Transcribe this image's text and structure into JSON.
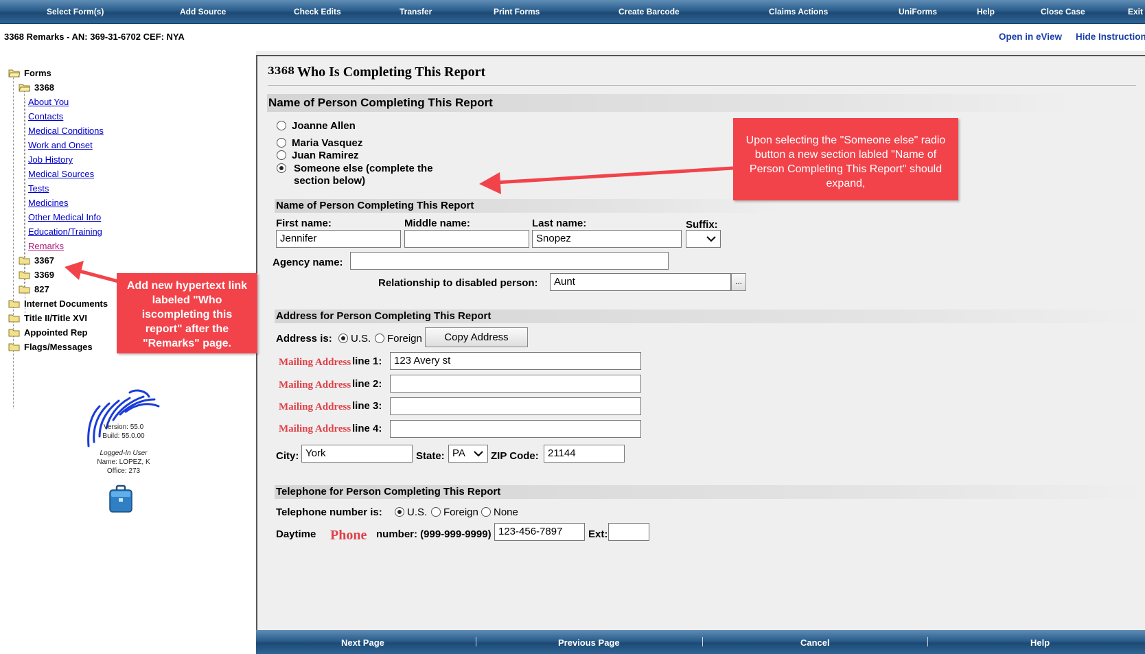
{
  "menu": {
    "items": [
      "Select Form(s)",
      "Add Source",
      "Check Edits",
      "Transfer",
      "Print Forms",
      "Create Barcode",
      "Claims Actions",
      "UniForms",
      "Help",
      "Close Case",
      "Exit"
    ]
  },
  "subheader": {
    "case_title": "3368 Remarks - AN: 369-31-6702 CEF: NYA",
    "open_eview": "Open in eView",
    "hide_instructions": "Hide Instruction"
  },
  "tree": {
    "forms": "Forms",
    "form_3368": "3368",
    "pages": [
      "About You",
      "Contacts",
      "Medical Conditions",
      "Work and Onset",
      "Job History",
      "Medical Sources",
      "Tests",
      "Medicines",
      "Other Medical Info",
      "Education/Training",
      "Remarks"
    ],
    "form_3367": "3367",
    "form_3369": "3369",
    "form_827": "827",
    "internet_documents": "Internet Documents",
    "title_ii_xvi": "Title II/Title XVI",
    "appointed_rep": "Appointed Rep",
    "flags_messages": "Flags/Messages"
  },
  "app_info": {
    "version": "Version: 55.0",
    "build": "Build: 55.0.00",
    "logged_in": "Logged-In User",
    "name": "Name: LOPEZ, K",
    "office": "Office: 273"
  },
  "form": {
    "number": "3368",
    "title": "Who Is Completing This Report",
    "section_name": "Name of Person Completing This Report",
    "options": [
      "Joanne Allen",
      "Maria Vasquez",
      "Juan Ramirez"
    ],
    "someone_else_line1": "Someone else (complete the",
    "someone_else_line2": "section below)",
    "subsection_name": "Name of Person Completing This Report",
    "first_name_label": "First name:",
    "middle_name_label": "Middle name:",
    "last_name_label": "Last name:",
    "suffix_label": "Suffix:",
    "first_name": "Jennifer",
    "middle_name": "",
    "last_name": "Snopez",
    "suffix": "",
    "agency_label": "Agency name:",
    "agency_name": "",
    "relationship_label": "Relationship to disabled person:",
    "relationship": "Aunt",
    "ellipsis": "...",
    "address_section": "Address for Person Completing This Report",
    "address_is_label": "Address is:",
    "us_label": "U.S.",
    "foreign_label": "Foreign",
    "copy_address": "Copy Address",
    "mailing_address": "Mailing Address",
    "line_labels": [
      "line 1:",
      "line 2:",
      "line 3:",
      "line 4:"
    ],
    "lines": [
      "123 Avery st",
      "",
      "",
      ""
    ],
    "city_label": "City:",
    "city": "York",
    "state_label": "State:",
    "state": "PA",
    "zip_label": "ZIP Code:",
    "zip": "21144",
    "phone_section": "Telephone for Person Completing This Report",
    "phone_is_label": "Telephone number is:",
    "phone_us": "U.S.",
    "phone_foreign": "Foreign",
    "phone_none": "None",
    "daytime": "Daytime",
    "phone_word": "Phone",
    "number_label": "number: (999-999-9999)",
    "phone": "123-456-7897",
    "ext_label": "Ext:",
    "ext": ""
  },
  "bottom": {
    "next": "Next Page",
    "previous": "Previous Page",
    "cancel": "Cancel",
    "help": "Help"
  },
  "notes": {
    "right": "Upon selecting the \"Someone else\" radio button a new section labled \"Name of Person Completing This Report\" should expand,",
    "left": "Add new hypertext link labeled \"Who iscompleting this report\" after the \"Remarks\" page."
  },
  "colors": {
    "menubar": "#2a5d8c",
    "annotation": "#f2434b",
    "link": "#0000cc",
    "active_link": "#b0177d",
    "mailing_red": "#e04048"
  }
}
